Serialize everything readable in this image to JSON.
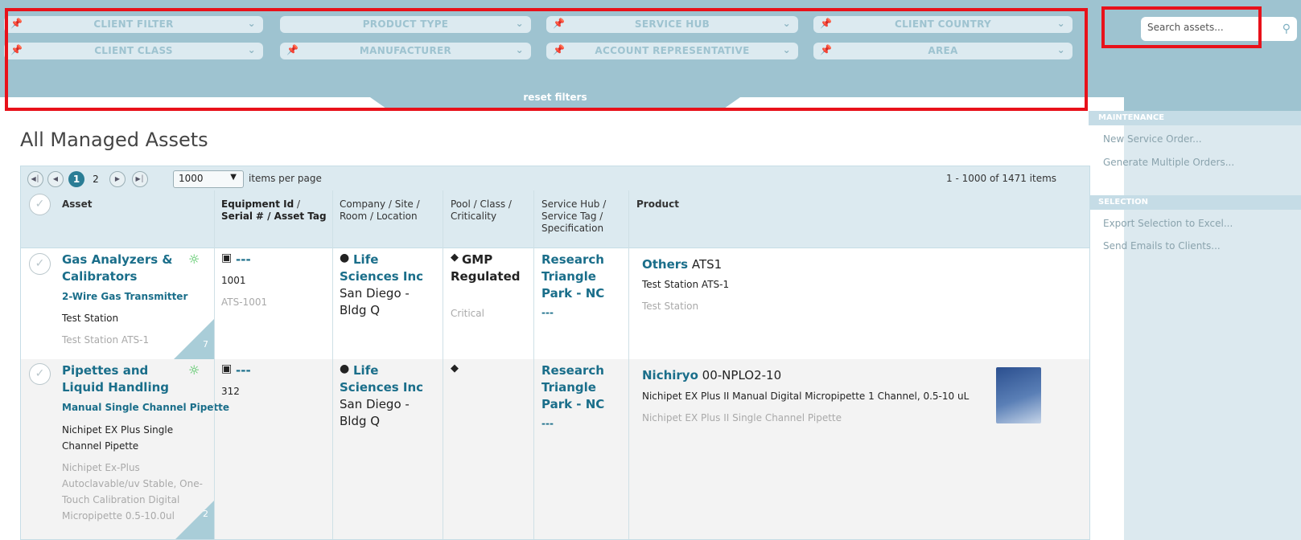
{
  "filters": {
    "row1": [
      "CLIENT FILTER",
      "PRODUCT TYPE",
      "SERVICE HUB",
      "CLIENT COUNTRY"
    ],
    "row2": [
      "CLIENT CLASS",
      "MANUFACTURER",
      "ACCOUNT REPRESENTATIVE",
      "AREA"
    ],
    "reset": "reset filters"
  },
  "search": {
    "placeholder": "Search assets..."
  },
  "sidebar": {
    "sections": [
      {
        "title": "MAINTENANCE",
        "items": [
          "New Service Order...",
          "Generate Multiple Orders..."
        ]
      },
      {
        "title": "SELECTION",
        "items": [
          "Export Selection to Excel...",
          "Send Emails to Clients..."
        ]
      }
    ]
  },
  "page": {
    "title": "All Managed Assets"
  },
  "pager": {
    "pages": [
      "1",
      "2"
    ],
    "active_page": "1",
    "page_size": "1000",
    "page_size_label": "items per page",
    "range": "1 - 1000 of 1471 items"
  },
  "columns": {
    "asset": "Asset",
    "equip_a": "Equipment Id",
    "equip_b": " / ",
    "equip_c": "Serial",
    "equip_d": "# / ",
    "equip_e": "Asset Tag",
    "company": "Company / Site / Room / Location",
    "pool": "Pool / Class / Criticality",
    "hub": "Service Hub / Service Tag / Specification",
    "product": "Product"
  },
  "rows": [
    {
      "type": "Gas Analyzers & Calibrators",
      "subtype": "2-Wire Gas Transmitter",
      "name": "Test Station",
      "desc": "Test Station ATS-1",
      "count": "7",
      "equip_id": "---",
      "serial": "1001",
      "tag": "ATS-1001",
      "company": "Life Sciences Inc",
      "site": "San Diego - Bldg Q",
      "pool": "GMP Regulated",
      "criticality": "Critical",
      "hub": "Research Triangle Park - NC",
      "service_tag": "---",
      "manufacturer": "Others",
      "model": "ATS1",
      "product_name": "Test Station ATS-1",
      "product_desc": "Test Station"
    },
    {
      "type": "Pipettes and Liquid Handling",
      "subtype": "Manual Single Channel Pipette",
      "name": "Nichipet EX Plus Single Channel Pipette",
      "desc": "Nichipet Ex-Plus Autoclavable/uv Stable, One-Touch Calibration Digital Micropipette 0.5-10.0ul",
      "count": "2",
      "equip_id": "---",
      "serial": "312",
      "company": "Life Sciences Inc",
      "site": "San Diego - Bldg Q",
      "hub": "Research Triangle Park - NC",
      "service_tag": "---",
      "manufacturer": "Nichiryo",
      "model": "00-NPLO2-10",
      "product_name": "Nichipet EX Plus II Manual Digital Micropipette 1 Channel, 0.5-10 uL",
      "product_desc": "Nichipet EX Plus II Single Channel Pipette"
    }
  ],
  "colors": {
    "accent": "#2a7d95",
    "link": "#1a6e8a",
    "filter_bg": "#9ec3d0",
    "highlight": "#e8111a"
  }
}
